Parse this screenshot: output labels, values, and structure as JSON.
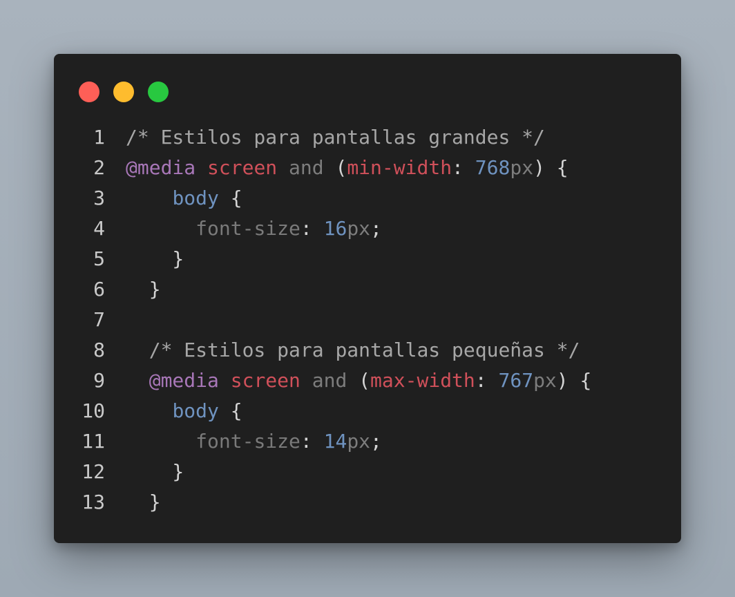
{
  "window": {
    "colors": {
      "background": "#1f1f1f",
      "dot_close": "#fe5f57",
      "dot_minimize": "#febc2e",
      "dot_maximize": "#28c840"
    },
    "dots": [
      {
        "name": "close-dot",
        "color": "#fe5f57"
      },
      {
        "name": "minimize-dot",
        "color": "#febc2e"
      },
      {
        "name": "maximize-dot",
        "color": "#28c840"
      }
    ]
  },
  "code": {
    "language": "css",
    "lines": [
      {
        "n": "1",
        "tokens": [
          {
            "t": "/* Estilos para pantallas grandes */",
            "k": "comment"
          }
        ]
      },
      {
        "n": "2",
        "tokens": [
          {
            "t": "@media",
            "k": "at"
          },
          {
            "t": " ",
            "k": "punc"
          },
          {
            "t": "screen",
            "k": "red"
          },
          {
            "t": " ",
            "k": "punc"
          },
          {
            "t": "and",
            "k": "and"
          },
          {
            "t": " (",
            "k": "punc"
          },
          {
            "t": "min-width",
            "k": "red"
          },
          {
            "t": ": ",
            "k": "punc"
          },
          {
            "t": "768",
            "k": "num"
          },
          {
            "t": "px",
            "k": "unit"
          },
          {
            "t": ") {",
            "k": "punc"
          }
        ]
      },
      {
        "n": "3",
        "tokens": [
          {
            "t": "    ",
            "k": "punc"
          },
          {
            "t": "body",
            "k": "sel"
          },
          {
            "t": " {",
            "k": "punc"
          }
        ]
      },
      {
        "n": "4",
        "tokens": [
          {
            "t": "      ",
            "k": "punc"
          },
          {
            "t": "font-size",
            "k": "prop"
          },
          {
            "t": ": ",
            "k": "punc"
          },
          {
            "t": "16",
            "k": "num"
          },
          {
            "t": "px",
            "k": "unit"
          },
          {
            "t": ";",
            "k": "punc"
          }
        ]
      },
      {
        "n": "5",
        "tokens": [
          {
            "t": "    }",
            "k": "punc"
          }
        ]
      },
      {
        "n": "6",
        "tokens": [
          {
            "t": "  }",
            "k": "punc"
          }
        ]
      },
      {
        "n": "7",
        "tokens": []
      },
      {
        "n": "8",
        "tokens": [
          {
            "t": "  ",
            "k": "punc"
          },
          {
            "t": "/* Estilos para pantallas pequeñas */",
            "k": "comment"
          }
        ]
      },
      {
        "n": "9",
        "tokens": [
          {
            "t": "  ",
            "k": "punc"
          },
          {
            "t": "@media",
            "k": "at"
          },
          {
            "t": " ",
            "k": "punc"
          },
          {
            "t": "screen",
            "k": "red"
          },
          {
            "t": " ",
            "k": "punc"
          },
          {
            "t": "and",
            "k": "and"
          },
          {
            "t": " (",
            "k": "punc"
          },
          {
            "t": "max-width",
            "k": "red"
          },
          {
            "t": ": ",
            "k": "punc"
          },
          {
            "t": "767",
            "k": "num"
          },
          {
            "t": "px",
            "k": "unit"
          },
          {
            "t": ") {",
            "k": "punc"
          }
        ]
      },
      {
        "n": "10",
        "tokens": [
          {
            "t": "    ",
            "k": "punc"
          },
          {
            "t": "body",
            "k": "sel"
          },
          {
            "t": " {",
            "k": "punc"
          }
        ]
      },
      {
        "n": "11",
        "tokens": [
          {
            "t": "      ",
            "k": "punc"
          },
          {
            "t": "font-size",
            "k": "prop"
          },
          {
            "t": ": ",
            "k": "punc"
          },
          {
            "t": "14",
            "k": "num"
          },
          {
            "t": "px",
            "k": "unit"
          },
          {
            "t": ";",
            "k": "punc"
          }
        ]
      },
      {
        "n": "12",
        "tokens": [
          {
            "t": "    }",
            "k": "punc"
          }
        ]
      },
      {
        "n": "13",
        "tokens": [
          {
            "t": "  }",
            "k": "punc"
          }
        ]
      }
    ]
  }
}
